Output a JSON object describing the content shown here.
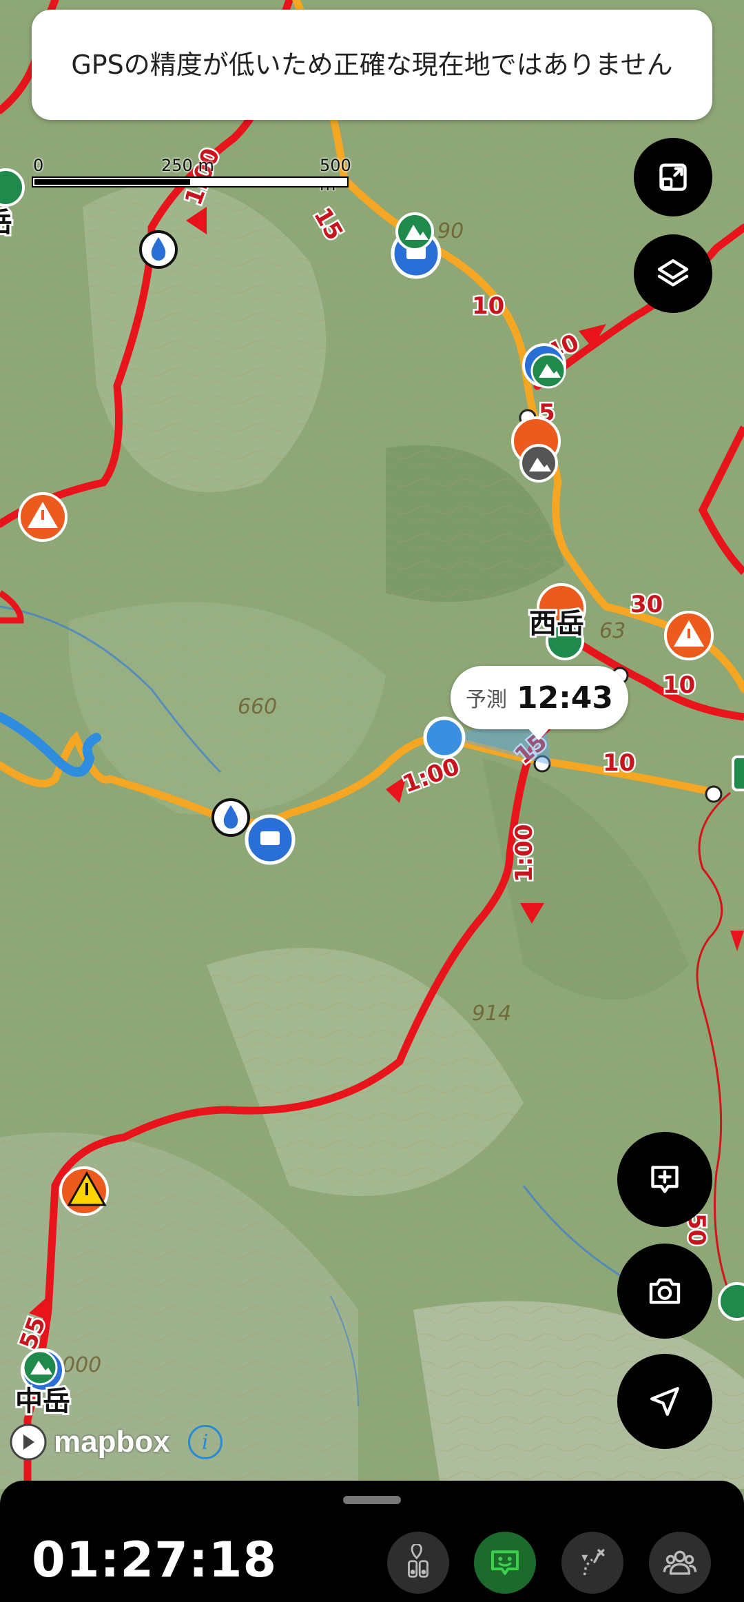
{
  "banner": {
    "message": "GPSの精度が低いため正確な現在地ではありません"
  },
  "scale_bar": {
    "labels": [
      "0",
      "250 m",
      "500 m"
    ]
  },
  "map": {
    "peaks": [
      {
        "name": "西岳"
      },
      {
        "name": "中岳"
      }
    ],
    "edge_label": "岳",
    "contour_labels": [
      "660",
      "914",
      "000",
      "90",
      "63"
    ],
    "route_times": [
      "1:00",
      "1:00",
      "1:00"
    ],
    "segment_minutes": [
      "10",
      "15",
      "10",
      "40",
      "5",
      "30",
      "10",
      "10",
      "15",
      "55",
      "50"
    ]
  },
  "eta": {
    "label": "予測",
    "time": "12:43"
  },
  "attribution": {
    "wordmark": "mapbox",
    "info": "i"
  },
  "buttons": {
    "fit": "fit-route-icon",
    "layers": "layers-icon",
    "add_note": "add-note-icon",
    "camera": "camera-icon",
    "locate": "navigation-arrow-icon"
  },
  "bottom_bar": {
    "elapsed": "01:27:18",
    "tools": [
      "route-marker-icon",
      "chat-face-icon",
      "route-branch-icon",
      "group-icon"
    ]
  },
  "colors": {
    "route_red": "#e8141c",
    "route_orange": "#f5a623",
    "marker_green": "#1f8a4c",
    "marker_blue": "#2a6fd6",
    "warning_orange": "#ec5a1e",
    "water_blue": "#3a8fe0",
    "active_tool_green": "#3ad24a"
  }
}
